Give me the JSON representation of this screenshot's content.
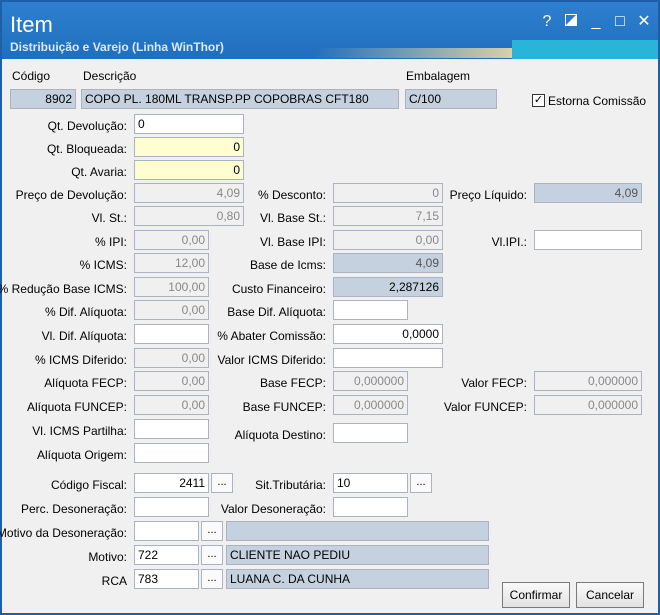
{
  "window": {
    "title": "Item",
    "subtitle": "Distribuição e Varejo (Linha WinThor)",
    "help": "?",
    "minimize": "_",
    "maximize": "□",
    "close": "✕"
  },
  "header": {
    "codigo_label": "Código",
    "codigo_value": "8902",
    "descricao_label": "Descrição",
    "descricao_value": "COPO PL. 180ML TRANSP.PP COPOBRAS CFT180",
    "embalagem_label": "Embalagem",
    "embalagem_value": "C/100",
    "estorna_label": "Estorna Comissão",
    "estorna_checked": true
  },
  "fields": {
    "qt_devolucao": {
      "label": "Qt. Devolução:",
      "value": "0"
    },
    "qt_bloqueada": {
      "label": "Qt. Bloqueada:",
      "value": "0"
    },
    "qt_avaria": {
      "label": "Qt. Avaria:",
      "value": "0"
    },
    "preco_devolucao": {
      "label": "Preço de Devolução:",
      "value": "4,09"
    },
    "perc_desconto": {
      "label": "% Desconto:",
      "value": "0"
    },
    "preco_liquido": {
      "label": "Preço Líquido:",
      "value": "4,09"
    },
    "vl_st": {
      "label": "Vl. St.:",
      "value": "0,80"
    },
    "vl_base_st": {
      "label": "Vl. Base St.:",
      "value": "7,15"
    },
    "perc_ipi": {
      "label": "% IPI:",
      "value": "0,00"
    },
    "vl_base_ipi": {
      "label": "Vl. Base IPI:",
      "value": "0,00"
    },
    "vl_ipi": {
      "label": "Vl.IPI.:",
      "value": ""
    },
    "perc_icms": {
      "label": "% ICMS:",
      "value": "12,00"
    },
    "base_icms": {
      "label": "Base de Icms:",
      "value": "4,09"
    },
    "perc_reducao": {
      "label": "% Redução Base ICMS:",
      "value": "100,00"
    },
    "custo_financeiro": {
      "label": "Custo Financeiro:",
      "value": "2,287126"
    },
    "perc_dif_aliquota": {
      "label": "% Dif. Alíquota:",
      "value": "0,00"
    },
    "base_dif_aliquota": {
      "label": "Base Dif. Alíquota:",
      "value": ""
    },
    "vl_dif_aliquota": {
      "label": "Vl. Dif. Alíquota:",
      "value": ""
    },
    "perc_abater": {
      "label": "% Abater Comissão:",
      "value": "0,0000"
    },
    "perc_icms_diferido": {
      "label": "% ICMS Diferido:",
      "value": "0,00"
    },
    "valor_icms_diferido": {
      "label": "Valor ICMS Diferido:",
      "value": ""
    },
    "aliquota_fecp": {
      "label": "Alíquota FECP:",
      "value": "0,00"
    },
    "base_fecp": {
      "label": "Base FECP:",
      "value": "0,000000"
    },
    "valor_fecp": {
      "label": "Valor FECP:",
      "value": "0,000000"
    },
    "aliquota_funcep": {
      "label": "Alíquota FUNCEP:",
      "value": "0,00"
    },
    "base_funcep": {
      "label": "Base FUNCEP:",
      "value": "0,000000"
    },
    "valor_funcep": {
      "label": "Valor FUNCEP:",
      "value": "0,000000"
    },
    "vl_icms_partilha": {
      "label": "Vl. ICMS Partilha:",
      "value": ""
    },
    "aliquota_destino": {
      "label": "Alíquota Destino:",
      "value": ""
    },
    "aliquota_origem": {
      "label": "Alíquota Origem:",
      "value": ""
    },
    "codigo_fiscal": {
      "label": "Código Fiscal:",
      "value": "2411"
    },
    "sit_tributaria": {
      "label": "Sit.Tributária:",
      "value": "10"
    },
    "perc_desoneracao": {
      "label": "Perc. Desoneração:",
      "value": ""
    },
    "valor_desoneracao": {
      "label": "Valor Desoneração:",
      "value": ""
    },
    "motivo_desoneracao": {
      "label": "Motivo da Desoneração:",
      "value": "",
      "desc": ""
    },
    "motivo": {
      "label": "Motivo:",
      "value": "722",
      "desc": "CLIENTE NAO PEDIU"
    },
    "rca": {
      "label": "RCA",
      "value": "783",
      "desc": "LUANA C. DA CUNHA"
    }
  },
  "lookup_label": "...",
  "buttons": {
    "confirmar": "Confirmar",
    "cancelar": "Cancelar"
  }
}
